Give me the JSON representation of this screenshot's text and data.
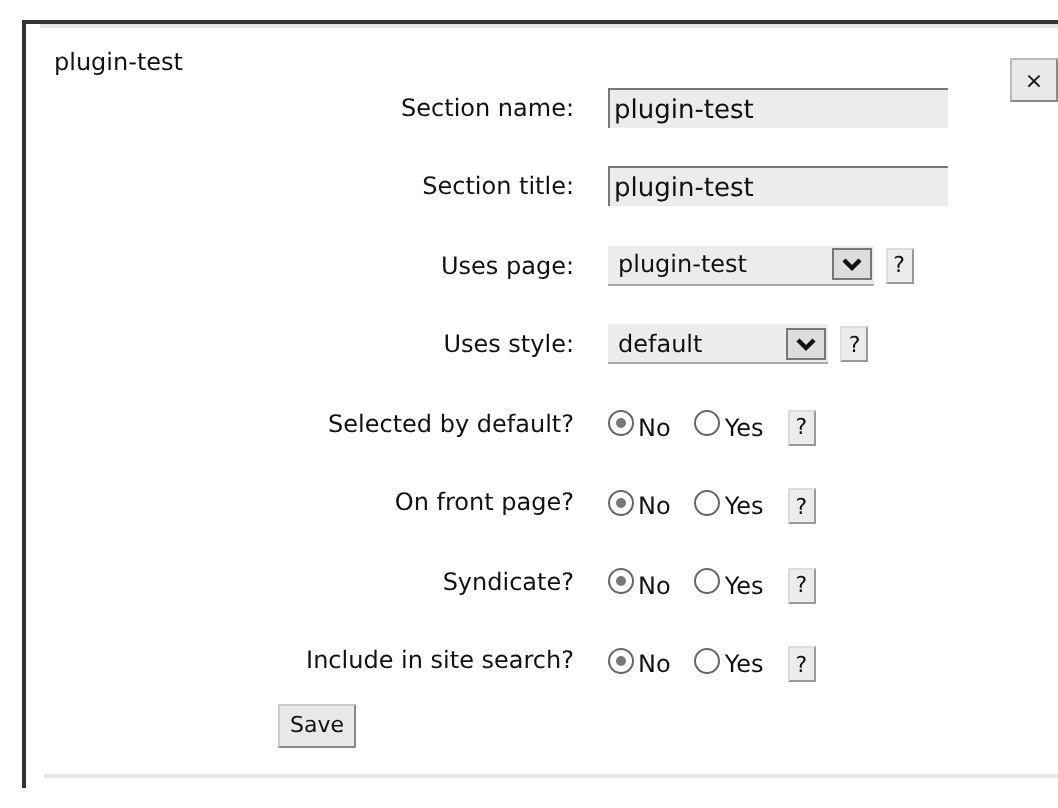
{
  "panel": {
    "title": "plugin-test",
    "close": "×"
  },
  "fields": [
    {
      "kind": "text",
      "label": "Section name:",
      "value": "plugin-test"
    },
    {
      "kind": "text",
      "label": "Section title:",
      "value": "plugin-test"
    },
    {
      "kind": "select",
      "label": "Uses page:",
      "value": "plugin-test",
      "help": "?"
    },
    {
      "kind": "select",
      "label": "Uses style:",
      "value": "default",
      "help": "?"
    },
    {
      "kind": "radio",
      "label": "Selected by default?",
      "options": [
        {
          "label": "No",
          "selected": true
        },
        {
          "label": "Yes",
          "selected": false
        }
      ],
      "help": "?"
    },
    {
      "kind": "radio",
      "label": "On front page?",
      "options": [
        {
          "label": "No",
          "selected": true
        },
        {
          "label": "Yes",
          "selected": false
        }
      ],
      "help": "?"
    },
    {
      "kind": "radio",
      "label": "Syndicate?",
      "options": [
        {
          "label": "No",
          "selected": true
        },
        {
          "label": "Yes",
          "selected": false
        }
      ],
      "help": "?"
    },
    {
      "kind": "radio",
      "label": "Include in site search?",
      "options": [
        {
          "label": "No",
          "selected": true
        },
        {
          "label": "Yes",
          "selected": false
        }
      ],
      "help": "?"
    }
  ],
  "save": "Save"
}
